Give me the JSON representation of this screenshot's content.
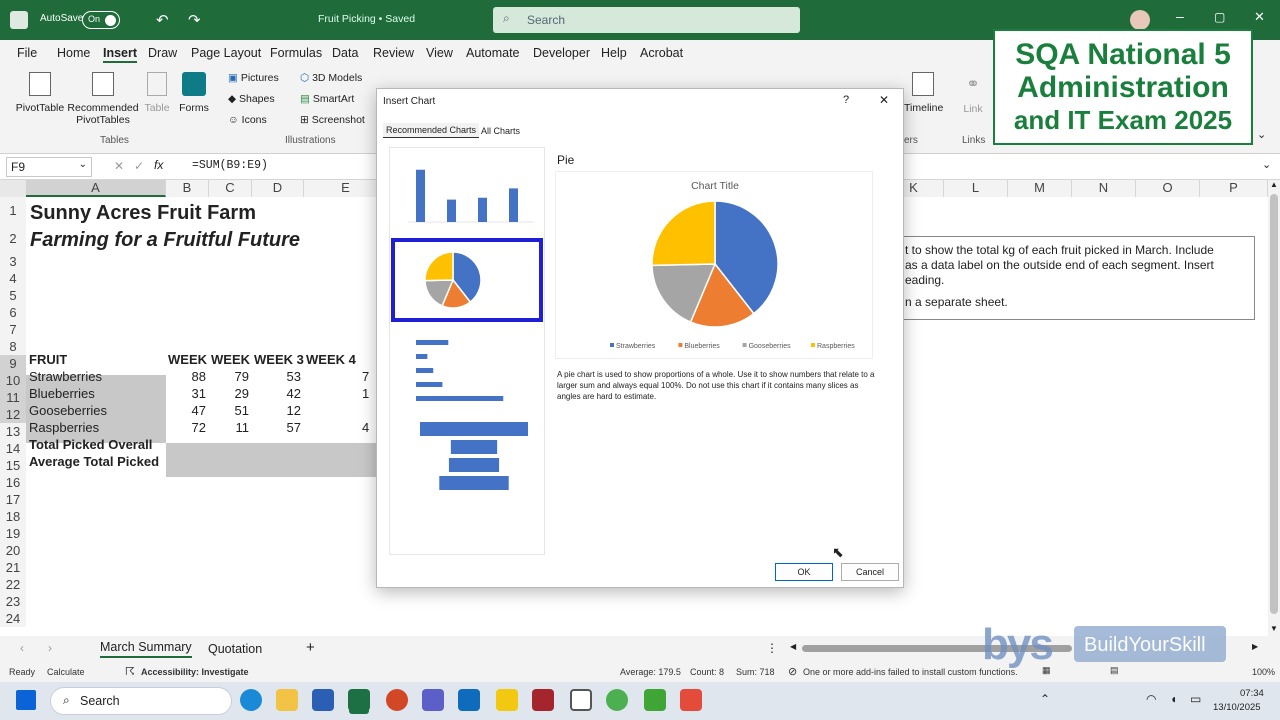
{
  "window": {
    "autosave_label": "AutoSave",
    "autosave_state": "On",
    "file_title": "Fruit Picking • Saved",
    "search_placeholder": "Search"
  },
  "menu": [
    "File",
    "Home",
    "Insert",
    "Draw",
    "Page Layout",
    "Formulas",
    "Data",
    "Review",
    "View",
    "Automate",
    "Developer",
    "Help",
    "Acrobat"
  ],
  "ribbon": {
    "pivottable": "PivotTable",
    "recommended_pivot_1": "Recommended",
    "recommended_pivot_2": "PivotTables",
    "table": "Table",
    "forms": "Forms",
    "group_tables": "Tables",
    "pictures": "Pictures",
    "shapes": "Shapes",
    "icons": "Icons",
    "models3d": "3D Models",
    "smartart": "SmartArt",
    "screenshot": "Screenshot",
    "group_illustrations": "Illustrations",
    "timeline": "Timeline",
    "link": "Link",
    "group_links": "Links",
    "group_filters_partial": "ers"
  },
  "overlay": {
    "line1": "SQA National 5",
    "line2": "Administration",
    "line3": "and IT Exam 2025"
  },
  "formula_bar": {
    "name_box": "F9",
    "formula": "=SUM(B9:E9)"
  },
  "columns": [
    "A",
    "B",
    "C",
    "D",
    "E",
    "K",
    "L",
    "M",
    "N",
    "O",
    "P"
  ],
  "rows": [
    "1",
    "2",
    "3",
    "4",
    "5",
    "6",
    "7",
    "8",
    "9",
    "10",
    "11",
    "12",
    "13",
    "14",
    "15",
    "16",
    "17",
    "18",
    "19",
    "20",
    "21",
    "22",
    "23",
    "24"
  ],
  "sheet": {
    "title": "Sunny Acres Fruit Farm",
    "subtitle": "Farming for a Fruitful Future",
    "headers": [
      "FRUIT",
      "WEEK",
      "WEEK",
      "WEEK 3",
      "WEEK 4"
    ],
    "fruits": [
      {
        "name": "Strawberries",
        "w1": "88",
        "w2": "79",
        "w3": "53",
        "w4_partial": "7"
      },
      {
        "name": "Blueberries",
        "w1": "31",
        "w2": "29",
        "w3": "42",
        "w4_partial": "1"
      },
      {
        "name": "Gooseberries",
        "w1": "47",
        "w2": "51",
        "w3": "12",
        "w4_partial": ""
      },
      {
        "name": "Raspberries",
        "w1": "72",
        "w2": "11",
        "w3": "57",
        "w4_partial": "4"
      }
    ],
    "total_label": "Total Picked Overall",
    "average_label": "Average Total Picked"
  },
  "task_box": {
    "line1": "t to show the total kg of each fruit picked in March. Include",
    "line2": "as a data label on the outside end of each segment. Insert",
    "line3": "eading.",
    "line4": "n a separate sheet."
  },
  "dialog": {
    "title": "Insert Chart",
    "help": "?",
    "close": "✕",
    "tabs": [
      "Recommended Charts",
      "All Charts"
    ],
    "preview_heading": "Pie",
    "preview_chart_title": "Chart Title",
    "description": "A pie chart is used to show proportions of a whole. Use it to show numbers that relate to a larger sum and always equal 100%. Do not use this chart if it contains many slices as angles are hard to estimate.",
    "ok": "OK",
    "cancel": "Cancel"
  },
  "chart_data": {
    "type": "pie",
    "title": "Chart Title",
    "categories": [
      "Strawberries",
      "Blueberries",
      "Gooseberries",
      "Raspberries"
    ],
    "values": [
      280,
      120,
      130,
      180
    ],
    "colors": [
      "#4472c4",
      "#ed7d31",
      "#a5a5a5",
      "#ffc000"
    ],
    "legend": "bottom"
  },
  "sheet_tabs": [
    "March Summary",
    "Quotation"
  ],
  "status": {
    "ready": "Ready",
    "calculate": "Calculate",
    "accessibility": "Accessibility: Investigate",
    "average": "Average: 179.5",
    "count": "Count: 8",
    "sum": "Sum: 718",
    "addins": "One or more add-ins failed to install custom functions.",
    "zoom": "100%"
  },
  "watermark": "BuildYourSkill",
  "taskbar": {
    "search": "Search",
    "time": "07:34",
    "date": "13/10/2025"
  },
  "colors": {
    "excel_green": "#1f6b3a",
    "overlay_text": "#1a7f3c",
    "selection_blue": "#1f1fd6"
  }
}
